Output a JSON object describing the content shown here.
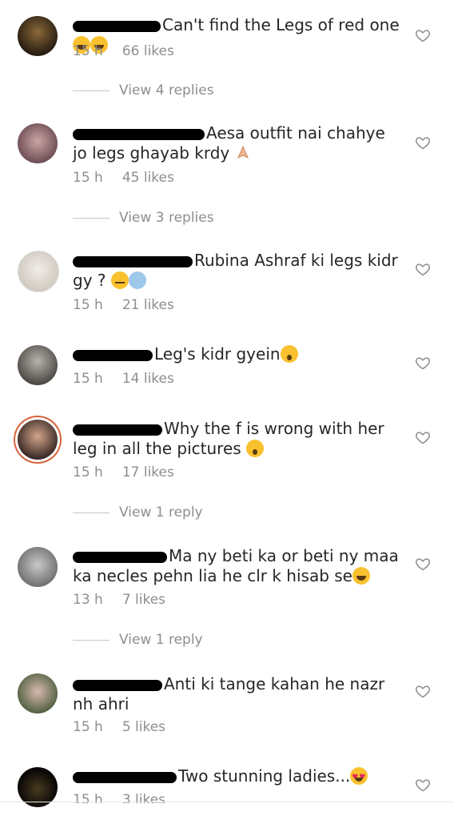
{
  "comments": [
    {
      "text": "Can't find the Legs of red one",
      "emoji": "laugh2",
      "time": "15 h",
      "likes": "66 likes",
      "replies": "View 4 replies"
    },
    {
      "text": "Aesa outfit nai chahye jo legs ghayab krdy",
      "emoji": "pray",
      "time": "15 h",
      "likes": "45 likes",
      "replies": "View 3 replies"
    },
    {
      "text": "Rubina Ashraf ki legs kidr gy ?",
      "emoji": "eyes-scream",
      "time": "15 h",
      "likes": "21 likes",
      "replies": ""
    },
    {
      "text": "Leg's kidr gyein",
      "emoji": "wow",
      "time": "15 h",
      "likes": "14 likes",
      "replies": ""
    },
    {
      "text": "Why the f is wrong with her leg in all the pictures",
      "emoji": "wow",
      "time": "15 h",
      "likes": "17 likes",
      "replies": "View 1 reply"
    },
    {
      "text": "Ma ny beti ka or beti ny maa ka necles pehn lia he clr k hisab se",
      "emoji": "laugh",
      "time": "13 h",
      "likes": "7 likes",
      "replies": "View 1 reply"
    },
    {
      "text": "Anti ki tange kahan he nazr nh ahri",
      "emoji": "",
      "time": "15 h",
      "likes": "5 likes",
      "replies": ""
    },
    {
      "text": "Two stunning ladies...",
      "emoji": "heart-eyes",
      "time": "15 h",
      "likes": "3 likes",
      "replies": ""
    }
  ],
  "icons": {
    "like": "heart-outline-icon"
  },
  "colors": {
    "text": "#262626",
    "meta": "#8e8e8e",
    "ring": "#d8623a"
  }
}
